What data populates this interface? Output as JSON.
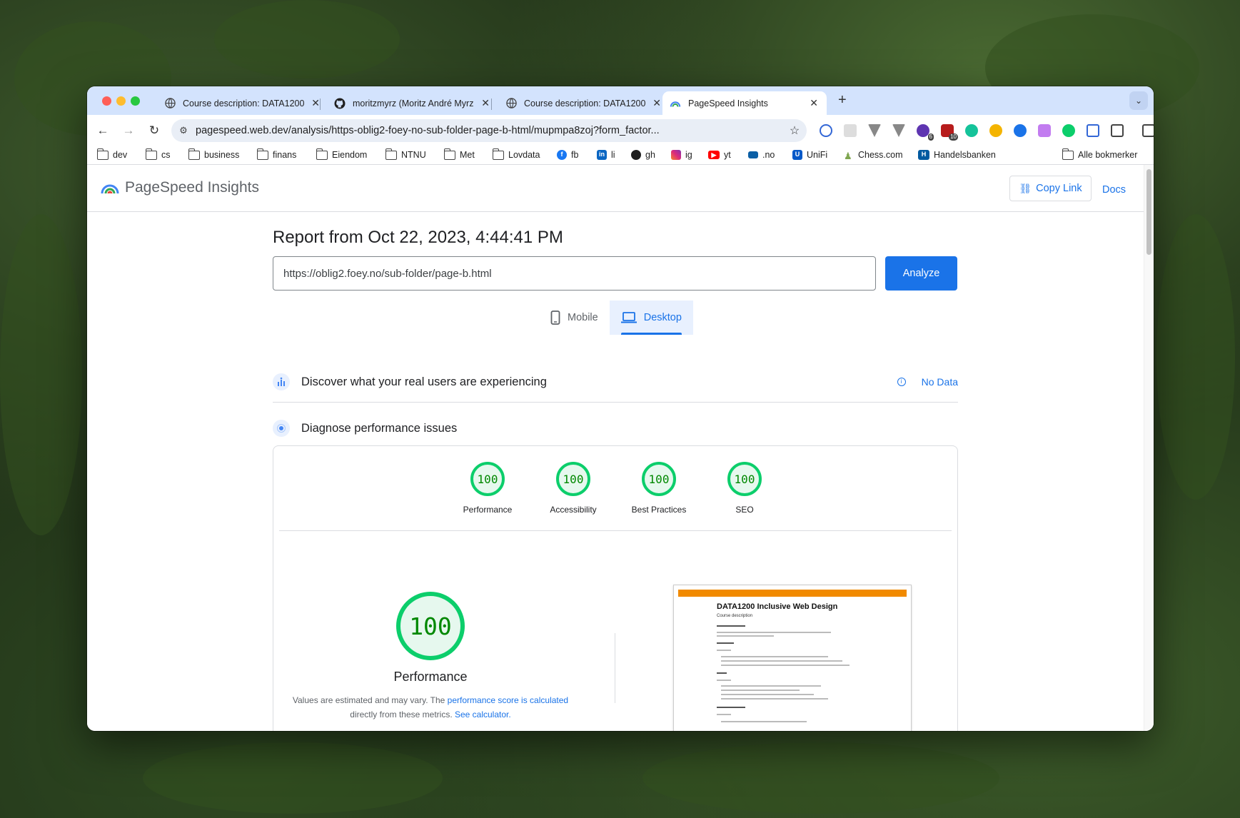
{
  "browser": {
    "tabs": [
      {
        "title": "Course description: DATA1200",
        "active": false,
        "favicon": "globe-icon"
      },
      {
        "title": "moritzmyrz (Moritz André Myrz",
        "active": false,
        "favicon": "github-icon"
      },
      {
        "title": "Course description: DATA1200",
        "active": false,
        "favicon": "globe-icon"
      },
      {
        "title": "PageSpeed Insights",
        "active": true,
        "favicon": "pagespeed-icon"
      }
    ],
    "new_tab_label": "+",
    "url": "pagespeed.web.dev/analysis/https-oblig2-foey-no-sub-folder-page-b-html/mupmpa8zoj?form_factor...",
    "extension_badges": [
      "6",
      "10"
    ],
    "bookmarks": [
      {
        "label": "dev",
        "icon": "folder-icon"
      },
      {
        "label": "cs",
        "icon": "folder-icon"
      },
      {
        "label": "business",
        "icon": "folder-icon"
      },
      {
        "label": "finans",
        "icon": "folder-icon"
      },
      {
        "label": "Eiendom",
        "icon": "folder-icon"
      },
      {
        "label": "NTNU",
        "icon": "folder-icon"
      },
      {
        "label": "Met",
        "icon": "folder-icon"
      },
      {
        "label": "Lovdata",
        "icon": "folder-icon"
      },
      {
        "label": "fb",
        "icon": "facebook-icon"
      },
      {
        "label": "li",
        "icon": "linkedin-icon"
      },
      {
        "label": "gh",
        "icon": "github-icon"
      },
      {
        "label": "ig",
        "icon": "instagram-icon"
      },
      {
        "label": "yt",
        "icon": "youtube-icon"
      },
      {
        "label": ".no",
        "icon": "domeneshop-icon"
      },
      {
        "label": "UniFi",
        "icon": "unifi-icon"
      },
      {
        "label": "Chess.com",
        "icon": "chess-pawn-icon"
      },
      {
        "label": "Handelsbanken",
        "icon": "handelsbanken-icon"
      }
    ],
    "all_bookmarks_label": "Alle bokmerker"
  },
  "psi": {
    "logo_text": "PageSpeed Insights",
    "copy_link_label": "Copy Link",
    "docs_label": "Docs",
    "report_date": "Report from Oct 22, 2023, 4:44:41 PM",
    "url_input_value": "https://oblig2.foey.no/sub-folder/page-b.html",
    "analyze_label": "Analyze",
    "device_tabs": [
      {
        "label": "Mobile",
        "active": false
      },
      {
        "label": "Desktop",
        "active": true
      }
    ],
    "real_users_title": "Discover what your real users are experiencing",
    "no_data_label": "No Data",
    "diagnose_title": "Diagnose performance issues",
    "scores": [
      {
        "label": "Performance",
        "value": "100"
      },
      {
        "label": "Accessibility",
        "value": "100"
      },
      {
        "label": "Best Practices",
        "value": "100"
      },
      {
        "label": "SEO",
        "value": "100"
      }
    ],
    "big_score": {
      "value": "100",
      "label": "Performance"
    },
    "perf_note": {
      "prefix": "Values are estimated and may vary. The ",
      "link1": "performance score is calculated",
      "middle": " directly from these metrics. ",
      "link2": "See calculator."
    },
    "screenshot": {
      "title": "DATA1200 Inclusive Web Design",
      "subtitle": "Course description"
    },
    "colors": {
      "accent": "#1a73e8",
      "pass": "#0cce6b",
      "pass_text": "#008800"
    }
  }
}
